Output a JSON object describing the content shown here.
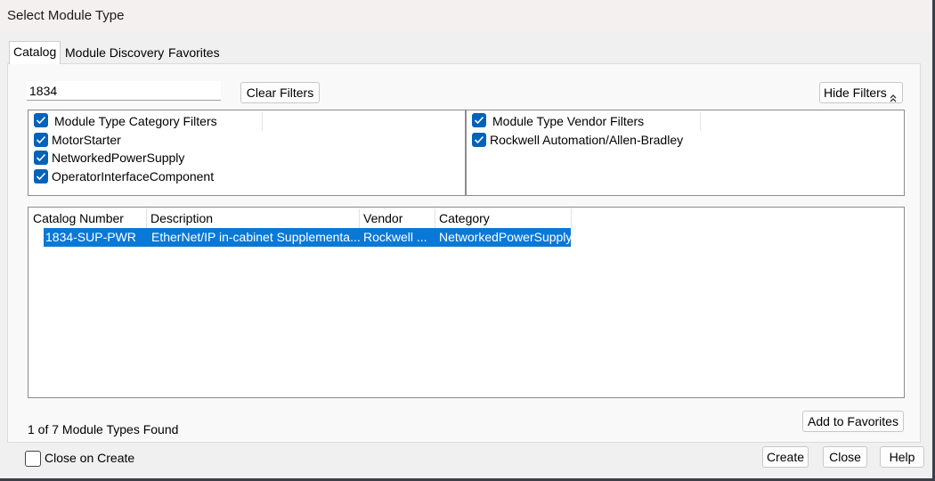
{
  "window": {
    "title": "Select Module Type"
  },
  "tabs": [
    {
      "label": "Catalog",
      "active": true
    },
    {
      "label": "Module Discovery",
      "active": false
    },
    {
      "label": "Favorites",
      "active": false
    }
  ],
  "search": {
    "value": "1834"
  },
  "buttons": {
    "clear_filters": "Clear Filters",
    "hide_filters": "Hide Filters",
    "add_to_favorites": "Add to Favorites",
    "create": "Create",
    "close": "Close",
    "help": "Help"
  },
  "category_filters": {
    "header": "Module Type Category Filters",
    "items": [
      {
        "label": "MotorStarter",
        "checked": true
      },
      {
        "label": "NetworkedPowerSupply",
        "checked": true
      },
      {
        "label": "OperatorInterfaceComponent",
        "checked": true
      }
    ]
  },
  "vendor_filters": {
    "header": "Module Type Vendor Filters",
    "items": [
      {
        "label": "Rockwell Automation/Allen-Bradley",
        "checked": true
      }
    ]
  },
  "results_table": {
    "columns": [
      "Catalog Number",
      "Description",
      "Vendor",
      "Category"
    ],
    "rows": [
      {
        "catalog_number": "1834-SUP-PWR",
        "description": "EtherNet/IP in-cabinet Supplementa...",
        "vendor": "Rockwell ...",
        "category": "NetworkedPowerSupply",
        "selected": true
      }
    ]
  },
  "status_text": "1 of 7 Module Types Found",
  "close_on_create": {
    "label": "Close on Create",
    "checked": false
  },
  "colors": {
    "accent": "#0062b8",
    "selection": "#0a78d7"
  }
}
